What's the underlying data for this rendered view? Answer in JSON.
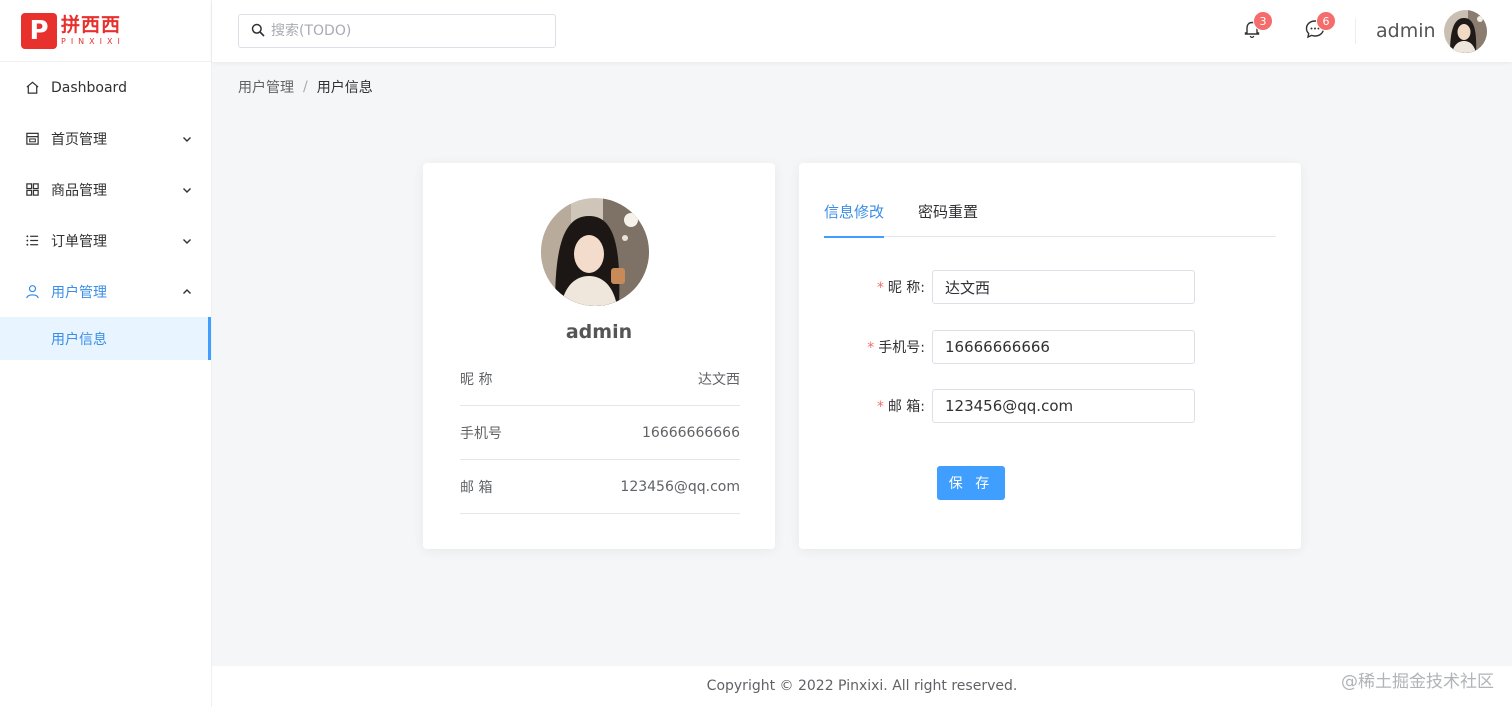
{
  "logo": {
    "mark": "P",
    "cn": "拼西西",
    "en": "PINXIXI"
  },
  "sidebar": {
    "items": [
      {
        "label": "Dashboard",
        "icon": "home-icon"
      },
      {
        "label": "首页管理",
        "icon": "calendar-icon"
      },
      {
        "label": "商品管理",
        "icon": "grid-icon"
      },
      {
        "label": "订单管理",
        "icon": "list-icon"
      },
      {
        "label": "用户管理",
        "icon": "user-icon"
      }
    ],
    "sub_items": [
      {
        "label": "用户信息"
      }
    ]
  },
  "header": {
    "search_placeholder": "搜索(TODO)",
    "notifications": "3",
    "messages": "6",
    "username": "admin"
  },
  "breadcrumb": {
    "parent": "用户管理",
    "separator": "/",
    "current": "用户信息"
  },
  "profile": {
    "name": "admin",
    "rows": [
      {
        "label": "昵 称",
        "value": "达文西"
      },
      {
        "label": "手机号",
        "value": "16666666666"
      },
      {
        "label": "邮 箱",
        "value": "123456@qq.com"
      }
    ]
  },
  "form": {
    "tabs": [
      "信息修改",
      "密码重置"
    ],
    "required_mark": "*",
    "fields": [
      {
        "label": "昵 称:",
        "value": "达文西"
      },
      {
        "label": "手机号:",
        "value": "16666666666"
      },
      {
        "label": "邮 箱:",
        "value": "123456@qq.com"
      }
    ],
    "save_label": "保 存"
  },
  "footer": {
    "text": "Copyright © 2022 Pinxixi. All right reserved."
  },
  "watermark": "@稀土掘金技术社区",
  "colors": {
    "primary": "#409eff",
    "brand": "#e8302d",
    "badge": "#f56c6c"
  }
}
